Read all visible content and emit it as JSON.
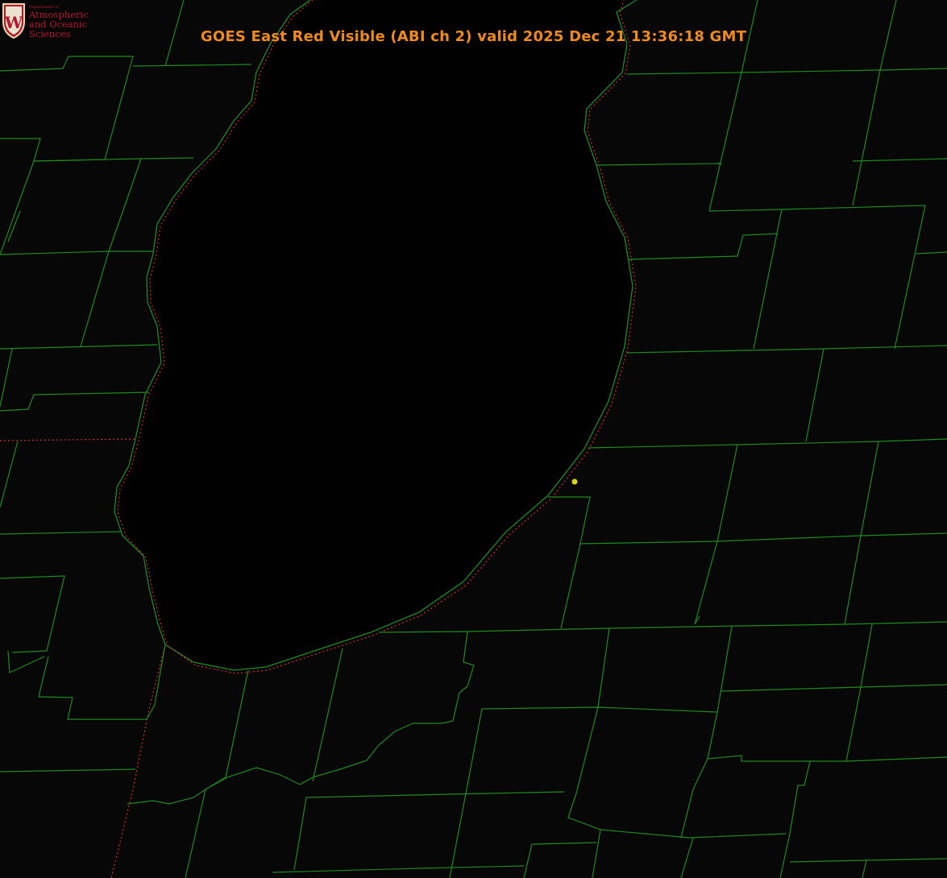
{
  "title": "GOES East Red Visible (ABI ch 2) valid 2025 Dec 21 13:36:18 GMT",
  "logo": {
    "department": "Department of",
    "line1": "Atmospheric",
    "line2": "and Oceanic Sciences",
    "seal_letter": "W"
  },
  "colors": {
    "background": "#070707",
    "lake": "#010101",
    "county_lines": "#1f8a1f",
    "state_line": "#d52b2b",
    "title": "#f08a1a",
    "logo_text": "#b5172e",
    "marker": "#d8d81c"
  },
  "layers": [
    "county-boundaries",
    "state-boundaries",
    "lake-shoreline",
    "point-marker"
  ]
}
